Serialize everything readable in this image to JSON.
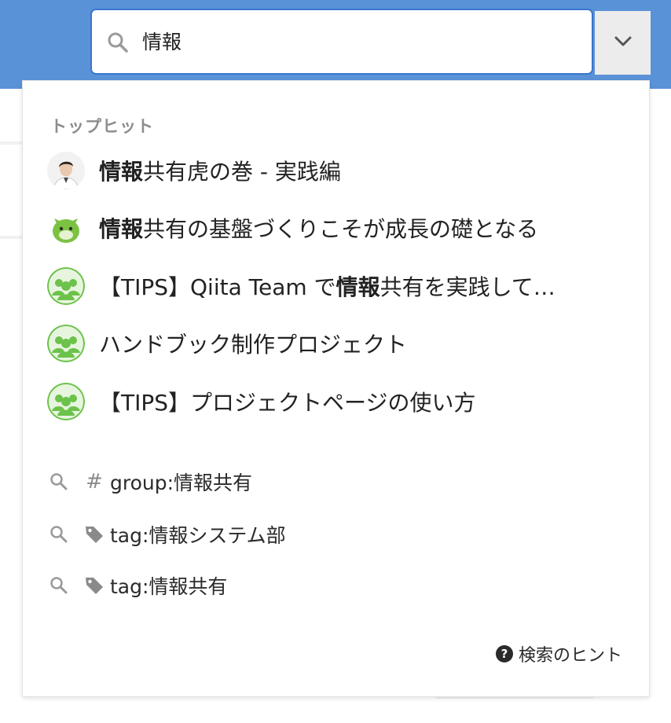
{
  "search": {
    "query": "情報",
    "placeholder": ""
  },
  "top_hits": {
    "label": "トップヒット",
    "items": [
      {
        "avatar": "person-photo",
        "highlight": "情報",
        "rest": "共有虎の巻 - 実践編"
      },
      {
        "avatar": "green-mascot",
        "highlight": "情報",
        "rest": "共有の基盤づくりこそが成長の礎となる"
      },
      {
        "avatar": "team-group",
        "prefix": "【TIPS】Qiita Team で",
        "highlight": "情報",
        "rest": "共有を実践して…"
      },
      {
        "avatar": "team-group",
        "text": "ハンドブック制作プロジェクト"
      },
      {
        "avatar": "team-group",
        "text": "【TIPS】プロジェクトページの使い方"
      }
    ]
  },
  "suggestions": [
    {
      "icon": "hash-icon",
      "symbol": "#",
      "text": "group:情報共有"
    },
    {
      "icon": "tag-icon",
      "text": "tag:情報システム部"
    },
    {
      "icon": "tag-icon",
      "text": "tag:情報共有"
    }
  ],
  "help": {
    "icon": "question-circle-icon",
    "symbol": "?",
    "label": "検索のヒント"
  },
  "colors": {
    "topbar": "#5a92d8",
    "focus_border": "#3a76cc",
    "group_green": "#6cc24a"
  }
}
